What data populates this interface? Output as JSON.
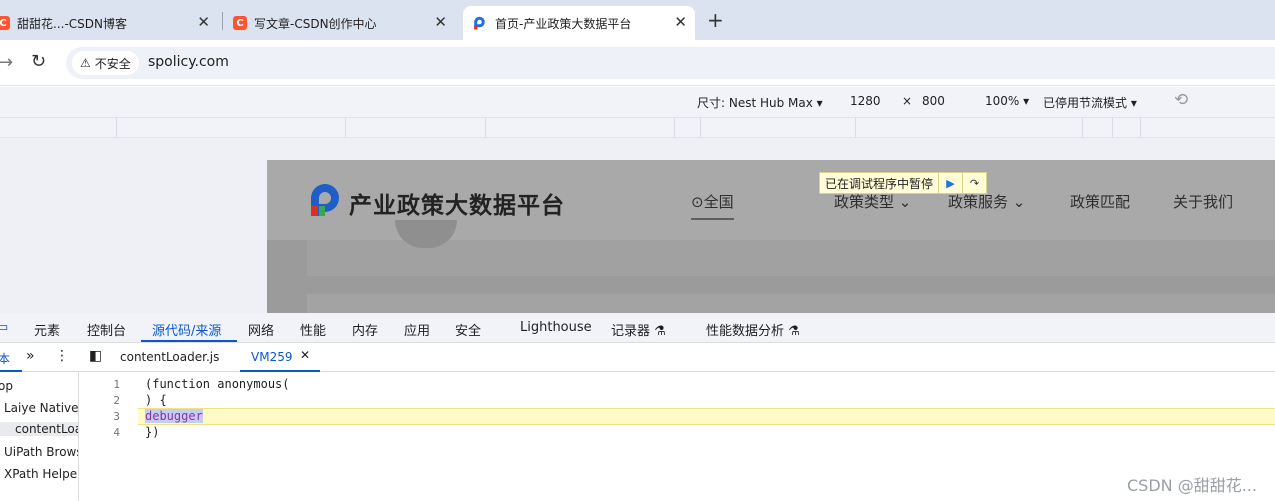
{
  "browser": {
    "tabs": [
      {
        "title": "甜甜花...-CSDN博客",
        "favicon": "csdn-icon"
      },
      {
        "title": "写文章-CSDN创作中心",
        "favicon": "csdn-icon"
      },
      {
        "title": "首页-产业政策大数据平台",
        "favicon": "spolicy-icon",
        "active": true
      }
    ],
    "new_tab_label": "+",
    "security_chip": "不安全",
    "url": "spolicy.com"
  },
  "device_toolbar": {
    "dimensions_label": "尺寸: Nest Hub Max",
    "width": "1280",
    "times": "×",
    "height": "800",
    "zoom": "100%",
    "throttle": "已停用节流模式"
  },
  "site": {
    "title": "产业政策大数据平台",
    "nav": [
      "全国",
      "政策类型",
      "政策服务",
      "政策匹配",
      "关于我们"
    ]
  },
  "paused_banner": "已在调试程序中暂停",
  "devtools": {
    "tabs": [
      "元素",
      "控制台",
      "源代码/来源",
      "网络",
      "性能",
      "内存",
      "应用",
      "安全",
      "Lighthouse",
      "记录器",
      "性能数据分析"
    ],
    "active_tab": "源代码/来源",
    "left_pane_tab": "本",
    "file_tabs": [
      "contentLoader.js",
      "VM259"
    ],
    "tree": [
      "op",
      "Laiye Native",
      "contentLoa",
      "UiPath Brows",
      "XPath Helper"
    ],
    "code_lines": [
      {
        "n": "1",
        "text": "(function anonymous("
      },
      {
        "n": "2",
        "text": ") {"
      },
      {
        "n": "3",
        "text": "debugger"
      },
      {
        "n": "4",
        "text": "})"
      }
    ]
  },
  "watermark": "CSDN @甜甜花...",
  "colors": {
    "accent": "#0b57d0",
    "csdn": "#fc5531",
    "paused_bg": "#fffdd6"
  }
}
